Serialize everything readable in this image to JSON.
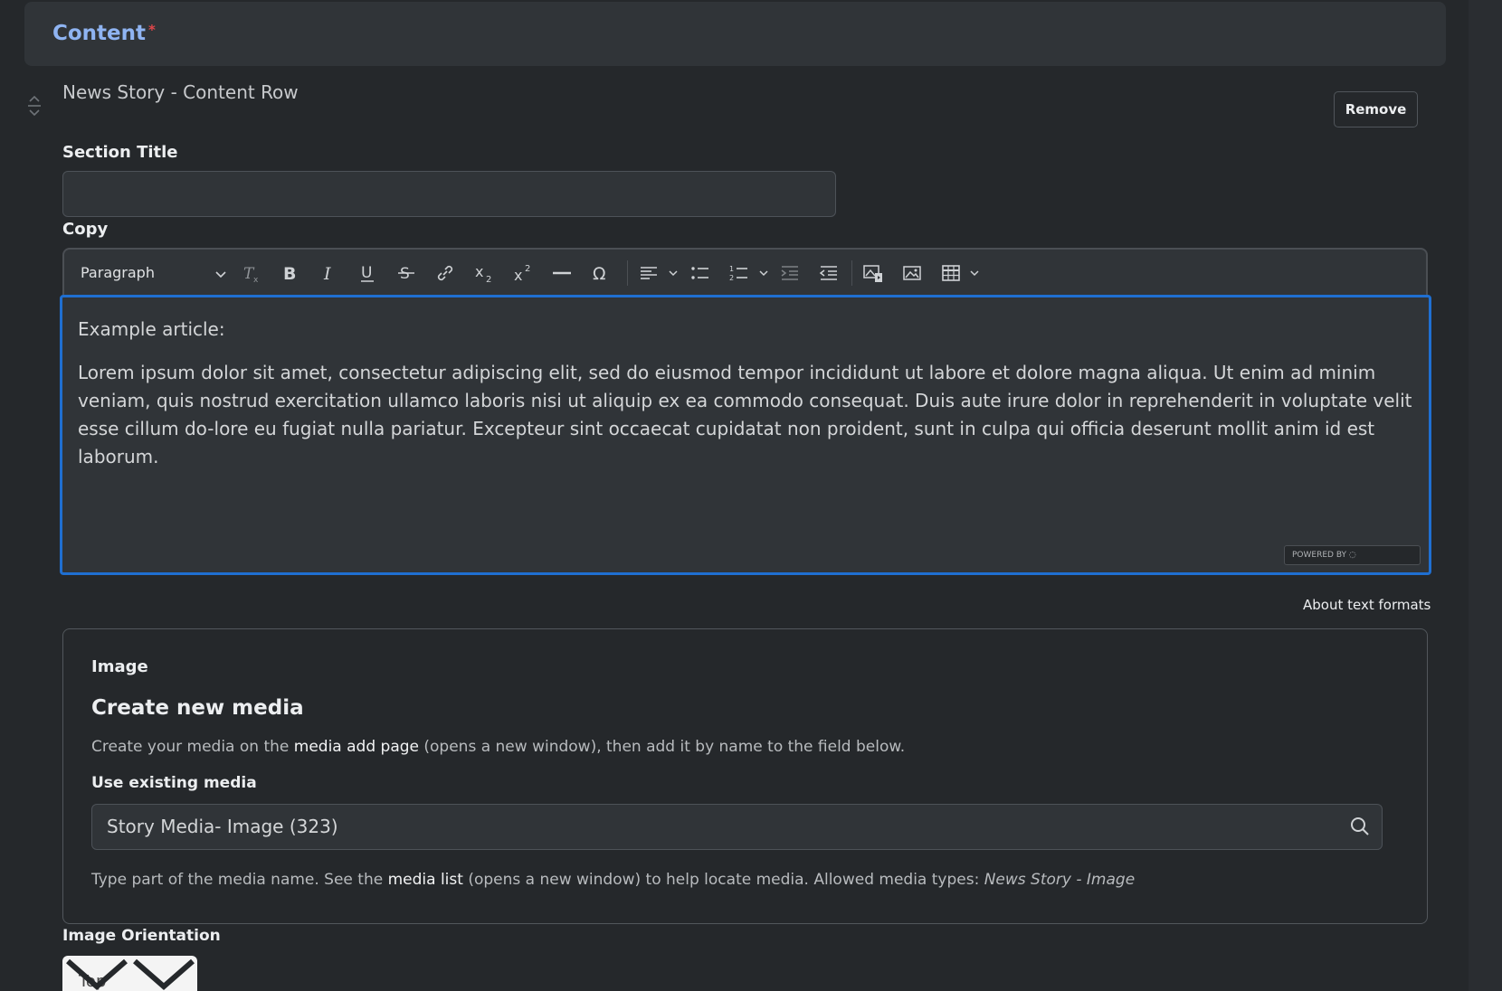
{
  "content_header": {
    "title": "Content",
    "required_marker": "*"
  },
  "row": {
    "title": "News Story - Content Row",
    "remove_label": "Remove"
  },
  "section_title": {
    "label": "Section Title",
    "value": ""
  },
  "copy": {
    "label": "Copy",
    "format_select": "Paragraph",
    "intro": "Example article:",
    "body": "Lorem ipsum dolor sit amet, consectetur adipiscing elit, sed do eiusmod tempor incididunt ut labore et dolore magna aliqua. Ut enim ad minim veniam, quis nostrud exercitation ullamco laboris nisi ut aliquip ex ea commodo consequat. Duis aute irure dolor in reprehenderit in voluptate velit esse cillum do-lore eu fugiat nulla pariatur. Excepteur sint occaecat cupidatat non proident, sunt in culpa qui officia deserunt mollit anim id est laborum.",
    "powered_by": "POWERED BY",
    "about_text_formats": "About text formats",
    "toolbar_icons": [
      "remove-format-icon",
      "bold-icon",
      "italic-icon",
      "underline-icon",
      "strikethrough-icon",
      "link-icon",
      "subscript-icon",
      "superscript-icon",
      "horizontal-line-icon",
      "special-characters-icon",
      "align-icon",
      "bulleted-list-icon",
      "numbered-list-icon",
      "indent-icon",
      "outdent-icon",
      "insert-media-icon",
      "insert-image-icon",
      "insert-table-icon"
    ]
  },
  "image": {
    "label": "Image",
    "create_heading": "Create new media",
    "create_desc_pre": "Create your media on the ",
    "create_desc_link": "media add page",
    "create_desc_post": " (opens a new window), then add it by name to the field below.",
    "use_existing_label": "Use existing media",
    "media_value": "Story Media- Image (323)",
    "help_pre": "Type part of the media name. See the ",
    "help_link": "media list",
    "help_mid": " (opens a new window) to help locate media. Allowed media types: ",
    "help_types": "News Story - Image"
  },
  "orientation": {
    "label": "Image Orientation",
    "value": "Top"
  },
  "colors": {
    "background": "#25282b",
    "panel": "#303438",
    "accent": "#8fb4f2",
    "focus": "#1f6fd1"
  }
}
